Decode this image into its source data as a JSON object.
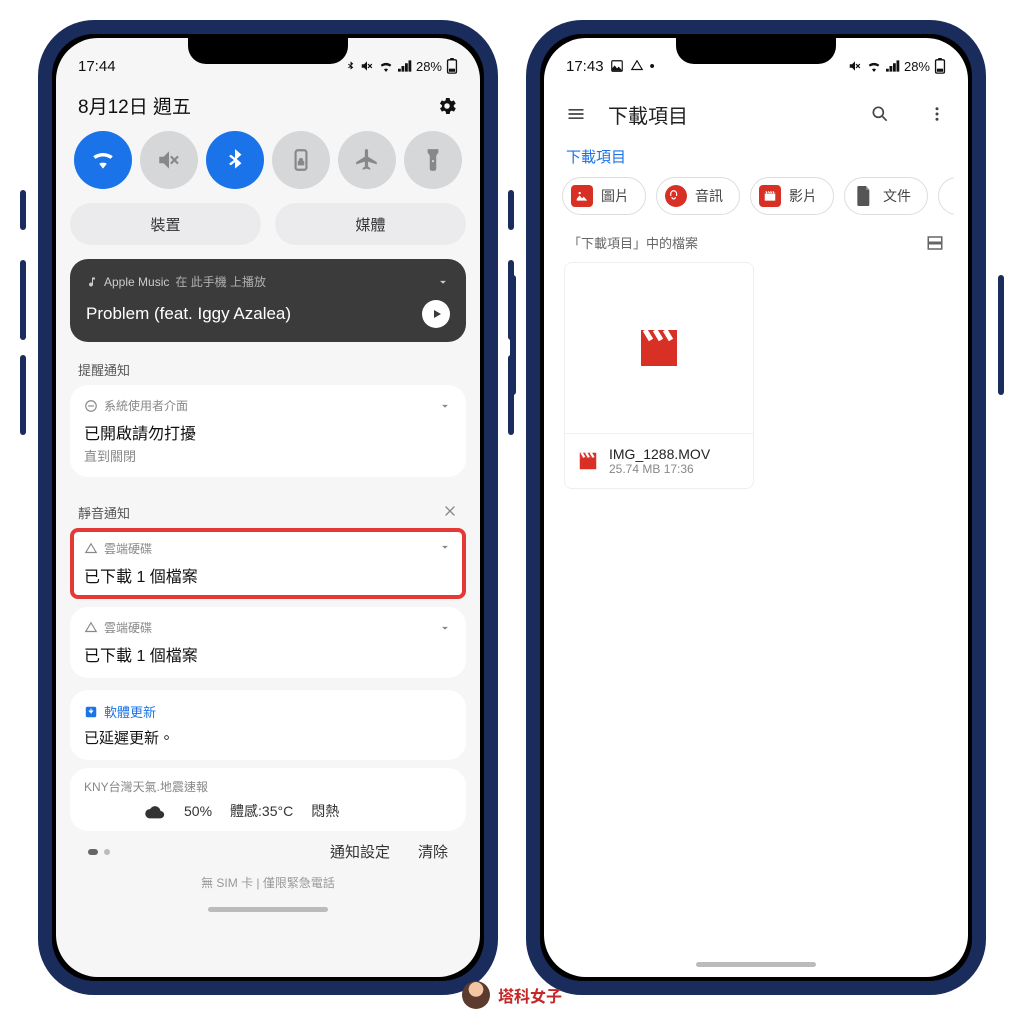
{
  "left": {
    "status": {
      "time": "17:44",
      "battery": "28%"
    },
    "date": "8月12日 週五",
    "qs": {
      "wifi": {
        "on": true
      },
      "mute": {
        "on": false
      },
      "bluetooth": {
        "on": true
      },
      "rotate": {
        "on": false
      },
      "airplane": {
        "on": false
      },
      "flashlight": {
        "on": false
      }
    },
    "wide": {
      "devices": "裝置",
      "media": "媒體"
    },
    "music": {
      "app": "Apple Music",
      "note": "在 此手機 上播放",
      "track": "Problem (feat. Iggy Azalea)"
    },
    "sections": {
      "alerts": "提醒通知",
      "silent": "靜音通知"
    },
    "alert1": {
      "app": "系統使用者介面",
      "line1": "已開啟請勿打擾",
      "line2": "直到關閉"
    },
    "drive1": {
      "app": "雲端硬碟",
      "line1": "已下載 1 個檔案"
    },
    "drive2": {
      "app": "雲端硬碟",
      "line1": "已下載 1 個檔案"
    },
    "sw": {
      "app": "軟體更新",
      "line1": "已延遲更新。"
    },
    "weather": {
      "app": "KNY台灣天氣.地震速報",
      "pct": "50%",
      "feel": "體感:35°C",
      "desc": "悶熱"
    },
    "footer": {
      "settings": "通知設定",
      "clear": "清除"
    },
    "sim": "無 SIM 卡 | 僅限緊急電話"
  },
  "right": {
    "status": {
      "time": "17:43",
      "battery": "28%"
    },
    "app_title": "下載項目",
    "breadcrumb": "下載項目",
    "chips": {
      "images": "圖片",
      "audio": "音訊",
      "video": "影片",
      "docs": "文件"
    },
    "files_header": "「下載項目」中的檔案",
    "file": {
      "name": "IMG_1288.MOV",
      "sub": "25.74 MB  17:36"
    }
  },
  "colors": {
    "accent": "#1a73e8",
    "highlight": "#e53935",
    "video_red": "#d93025"
  },
  "watermark": "塔科女子"
}
